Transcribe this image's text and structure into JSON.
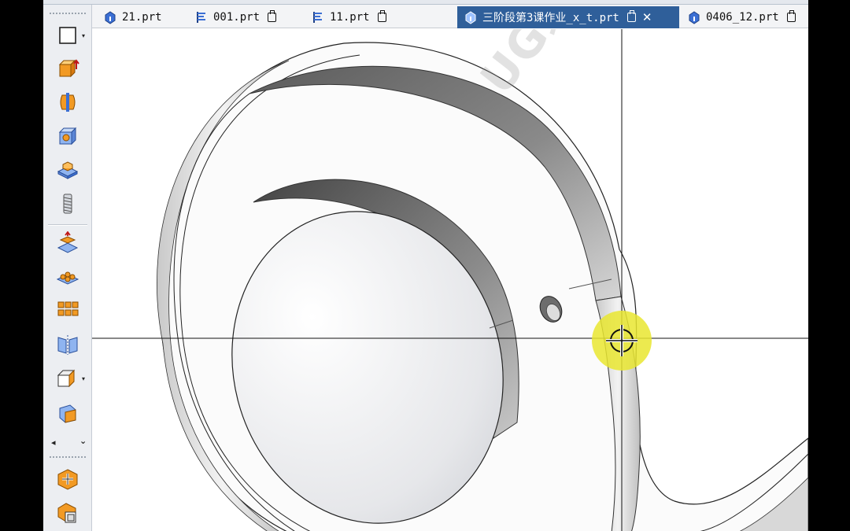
{
  "tabs": [
    {
      "label": "21.prt",
      "icon": "part-icon",
      "active": false,
      "pinnable": false
    },
    {
      "label": "001.prt",
      "icon": "assembly-part-icon",
      "active": false,
      "pinnable": true
    },
    {
      "label": "11.prt",
      "icon": "assembly-part-icon",
      "active": false,
      "pinnable": true
    },
    {
      "label": "三阶段第3课作业_x_t.prt",
      "icon": "part-icon",
      "active": true,
      "pinnable": true,
      "closable": true,
      "close_glyph": "✕"
    },
    {
      "label": "0406_12.prt",
      "icon": "part-icon",
      "active": false,
      "pinnable": true
    }
  ],
  "toolbar": {
    "items": [
      "select-rectangle-icon",
      "extrude-icon",
      "revolve-icon",
      "hole-icon",
      "boss-icon",
      "thread-icon",
      "offset-face-icon",
      "pattern-feature-icon",
      "pattern-face-icon",
      "mirror-icon",
      "block-feature-icon",
      "section-view-icon",
      "move-object-icon",
      "copy-object-icon"
    ],
    "scroll_left_glyph": "◂",
    "expand_glyph": "⌄"
  },
  "watermark": "UG编程",
  "colors": {
    "active_tab": "#2f5f9a",
    "highlight": "#e9e630",
    "toolbar_bg": "#eceef2",
    "icon_orange": "#f29a24",
    "icon_blue": "#3b6fd4"
  }
}
